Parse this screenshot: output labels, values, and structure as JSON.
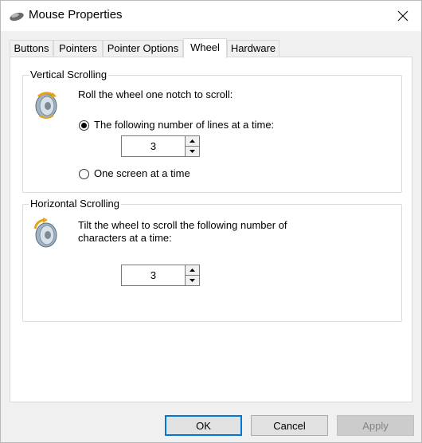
{
  "window": {
    "title": "Mouse Properties"
  },
  "tabs": [
    {
      "label": "Buttons",
      "active": false
    },
    {
      "label": "Pointers",
      "active": false
    },
    {
      "label": "Pointer Options",
      "active": false
    },
    {
      "label": "Wheel",
      "active": true
    },
    {
      "label": "Hardware",
      "active": false
    }
  ],
  "vertical": {
    "title": "Vertical Scrolling",
    "instruction": "Roll the wheel one notch to scroll:",
    "option_lines": "The following number of lines at a time:",
    "option_screen": "One screen at a time",
    "selected": "lines",
    "lines_value": "3"
  },
  "horizontal": {
    "title": "Horizontal Scrolling",
    "instruction_line1": "Tilt the wheel to scroll the following number of",
    "instruction_line2": "characters at a time:",
    "chars_value": "3"
  },
  "buttons": {
    "ok": "OK",
    "cancel": "Cancel",
    "apply": "Apply",
    "apply_enabled": false
  },
  "icons": {
    "title": "mouse-icon",
    "vertical": "vertical-wheel-icon",
    "horizontal": "horizontal-wheel-icon",
    "close": "close-icon"
  },
  "colors": {
    "accent": "#0078d7",
    "wheel_arrow": "#e8a317"
  }
}
